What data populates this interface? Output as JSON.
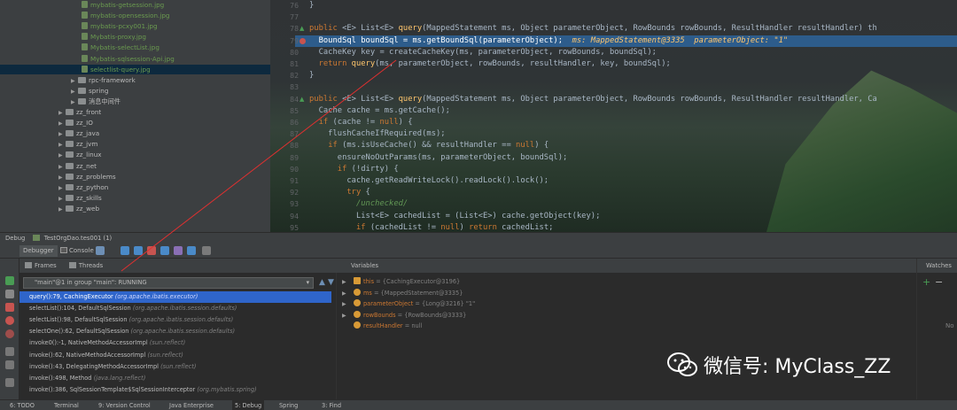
{
  "project_tree": {
    "items": [
      {
        "label": "mybatis-getsession.jpg",
        "kind": "file",
        "depth": 3
      },
      {
        "label": "mybatis-opensession.jpg",
        "kind": "file",
        "depth": 3
      },
      {
        "label": "mybatis-pcxy001.jpg",
        "kind": "file",
        "depth": 3
      },
      {
        "label": "Mybatis-proxy.jpg",
        "kind": "file",
        "depth": 3
      },
      {
        "label": "Mybatis-selectList.jpg",
        "kind": "file",
        "depth": 3
      },
      {
        "label": "Mybatis-sqlsession-Api.jpg",
        "kind": "file",
        "depth": 3
      },
      {
        "label": "selectlist-query.jpg",
        "kind": "file",
        "depth": 3,
        "selected": true
      },
      {
        "label": "rpc-framework",
        "kind": "folder",
        "depth": 2
      },
      {
        "label": "spring",
        "kind": "folder",
        "depth": 2
      },
      {
        "label": "消息中间件",
        "kind": "folder",
        "depth": 2
      },
      {
        "label": "zz_front",
        "kind": "folder",
        "depth": 1
      },
      {
        "label": "zz_IO",
        "kind": "folder",
        "depth": 1
      },
      {
        "label": "zz_java",
        "kind": "folder",
        "depth": 1
      },
      {
        "label": "zz_jvm",
        "kind": "folder",
        "depth": 1
      },
      {
        "label": "zz_linux",
        "kind": "folder",
        "depth": 1
      },
      {
        "label": "zz_net",
        "kind": "folder",
        "depth": 1
      },
      {
        "label": "zz_problems",
        "kind": "folder",
        "depth": 1
      },
      {
        "label": "zz_python",
        "kind": "folder",
        "depth": 1
      },
      {
        "label": "zz_skills",
        "kind": "folder",
        "depth": 1
      },
      {
        "label": "zz_web",
        "kind": "folder",
        "depth": 1
      }
    ]
  },
  "editor": {
    "lines": [
      {
        "n": "76",
        "text": "}"
      },
      {
        "n": "77",
        "text": ""
      },
      {
        "n": "78",
        "text": "public <E> List<E> query(MappedStatement ms, Object parameterObject, RowBounds rowBounds, ResultHandler resultHandler) th"
      },
      {
        "n": "79",
        "text": "  BoundSql boundSql = ms.getBoundSql(parameterObject);  ",
        "inline": "ms: MappedStatement@3335  parameterObject: \"1\"",
        "highlight": true
      },
      {
        "n": "80",
        "text": "  CacheKey key = createCacheKey(ms, parameterObject, rowBounds, boundSql);"
      },
      {
        "n": "81",
        "text": "  return query(ms, parameterObject, rowBounds, resultHandler, key, boundSql);"
      },
      {
        "n": "82",
        "text": "}"
      },
      {
        "n": "83",
        "text": ""
      },
      {
        "n": "84",
        "text": "public <E> List<E> query(MappedStatement ms, Object parameterObject, RowBounds rowBounds, ResultHandler resultHandler, Ca"
      },
      {
        "n": "85",
        "text": "  Cache cache = ms.getCache();"
      },
      {
        "n": "86",
        "text": "  if (cache != null) {"
      },
      {
        "n": "87",
        "text": "    flushCacheIfRequired(ms);"
      },
      {
        "n": "88",
        "text": "    if (ms.isUseCache() && resultHandler == null) {"
      },
      {
        "n": "89",
        "text": "      ensureNoOutParams(ms, parameterObject, boundSql);"
      },
      {
        "n": "90",
        "text": "      if (!dirty) {"
      },
      {
        "n": "91",
        "text": "        cache.getReadWriteLock().readLock().lock();"
      },
      {
        "n": "92",
        "text": "        try {"
      },
      {
        "n": "93",
        "text": "          /unchecked/",
        "comment": true
      },
      {
        "n": "94",
        "text": "          List<E> cachedList = (List<E>) cache.getObject(key);"
      },
      {
        "n": "95",
        "text": "          if (cachedList != null) return cachedList;"
      }
    ]
  },
  "debug": {
    "title": "Debug",
    "config": "TestOrgDao.tes001 (1)",
    "tabs": {
      "debugger": "Debugger",
      "console": "Console"
    },
    "frames_label": "Frames",
    "threads_label": "Threads",
    "thread_selector": "\"main\"@1 in group \"main\": RUNNING",
    "frames": [
      {
        "method": "query():79, CachingExecutor",
        "pkg": "(org.apache.ibatis.executor)",
        "selected": true
      },
      {
        "method": "selectList():104, DefaultSqlSession",
        "pkg": "(org.apache.ibatis.session.defaults)"
      },
      {
        "method": "selectList():98, DefaultSqlSession",
        "pkg": "(org.apache.ibatis.session.defaults)"
      },
      {
        "method": "selectOne():62, DefaultSqlSession",
        "pkg": "(org.apache.ibatis.session.defaults)"
      },
      {
        "method": "invoke0():-1, NativeMethodAccessorImpl",
        "pkg": "(sun.reflect)"
      },
      {
        "method": "invoke():62, NativeMethodAccessorImpl",
        "pkg": "(sun.reflect)"
      },
      {
        "method": "invoke():43, DelegatingMethodAccessorImpl",
        "pkg": "(sun.reflect)"
      },
      {
        "method": "invoke():498, Method",
        "pkg": "(java.lang.reflect)"
      },
      {
        "method": "invoke():386, SqlSessionTemplate$SqlSessionInterceptor",
        "pkg": "(org.mybatis.spring)"
      }
    ],
    "variables_label": "Variables",
    "variables": [
      {
        "name": "this",
        "value": "= {CachingExecutor@3196}"
      },
      {
        "name": "ms",
        "value": "= {MappedStatement@3335}"
      },
      {
        "name": "parameterObject",
        "value": "= {Long@3216} \"1\""
      },
      {
        "name": "rowBounds",
        "value": "= {RowBounds@3333}"
      },
      {
        "name": "resultHandler",
        "value": "= null"
      }
    ],
    "watches_label": "Watches",
    "watches_empty": "No"
  },
  "status_bar": {
    "items": [
      "6: TODO",
      "Terminal",
      "9: Version Control",
      "Java Enterprise",
      "5: Debug",
      "Spring",
      "3: Find"
    ]
  },
  "watermark": {
    "text": "微信号: MyClass_ZZ"
  },
  "colors": {
    "keyword": "#cc7832",
    "method": "#ffc66d",
    "selection": "#2f65ca",
    "highlight_line": "#2d5c8b"
  }
}
